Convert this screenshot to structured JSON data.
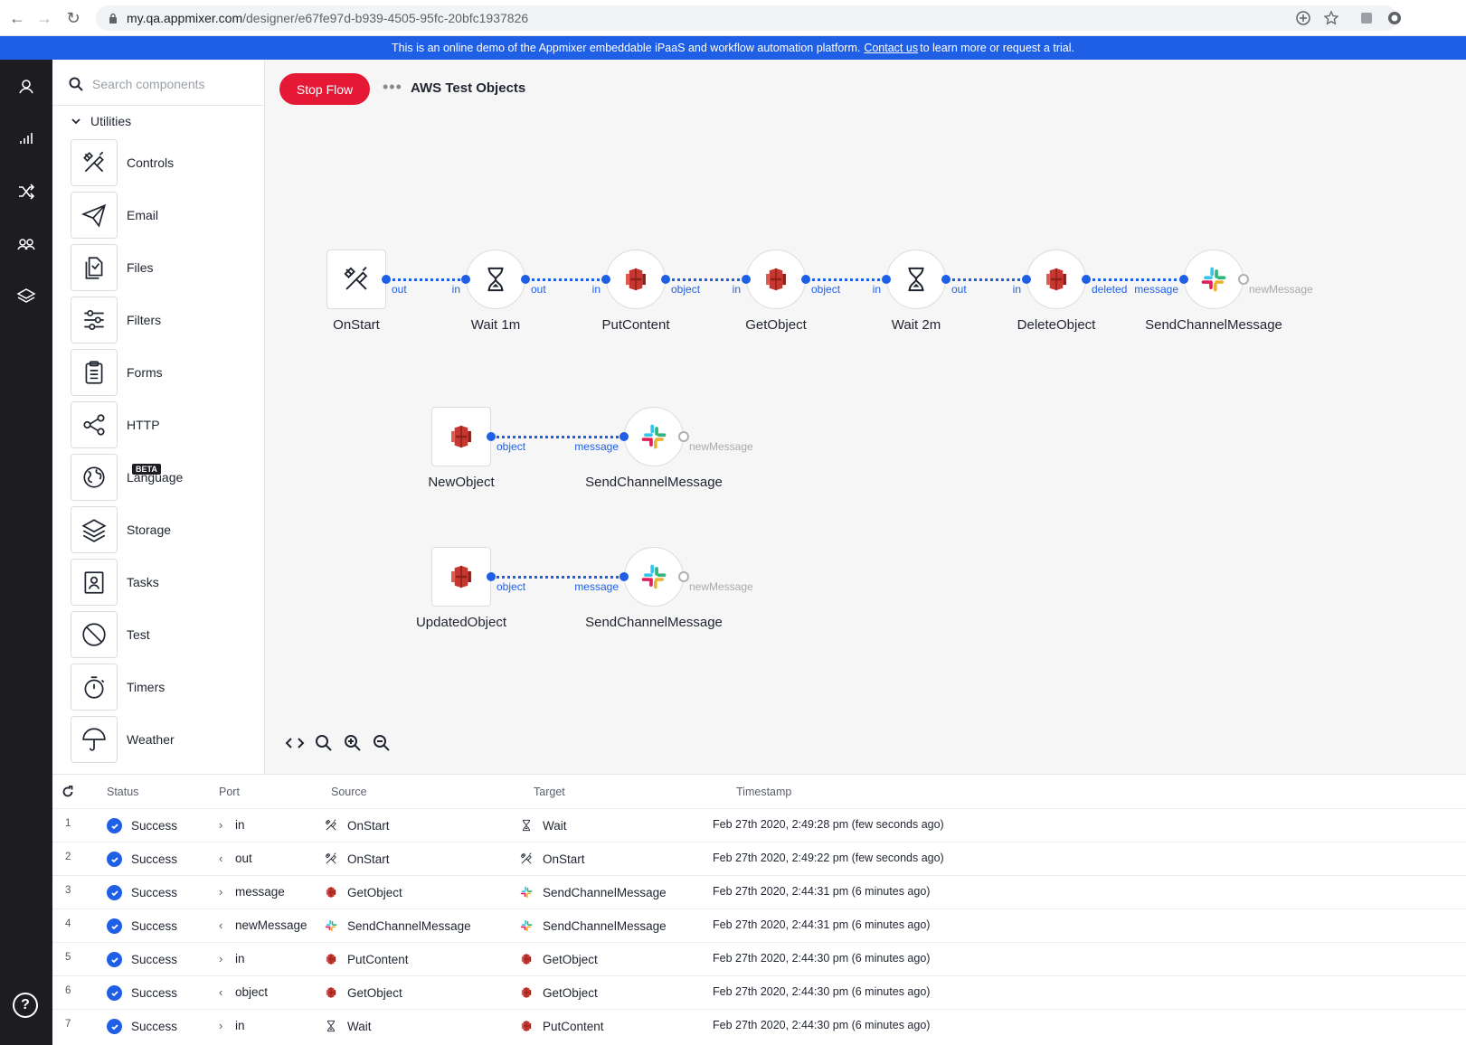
{
  "browser": {
    "url_host": "my.qa.appmixer.com",
    "url_path": "/designer/e67fe97d-b939-4505-95fc-20bfc1937826"
  },
  "banner": {
    "text": "This is an online demo of the Appmixer embeddable iPaaS and workflow automation platform.",
    "link": "Contact us",
    "suffix": "to learn more or request a trial."
  },
  "sidebar": {
    "search_placeholder": "Search components",
    "category": "Utilities",
    "beta_label": "BETA",
    "components": [
      {
        "label": "Controls",
        "icon": "tools-icon"
      },
      {
        "label": "Email",
        "icon": "paper-plane-icon"
      },
      {
        "label": "Files",
        "icon": "files-icon"
      },
      {
        "label": "Filters",
        "icon": "sliders-icon"
      },
      {
        "label": "Forms",
        "icon": "clipboard-icon"
      },
      {
        "label": "HTTP",
        "icon": "share-icon"
      },
      {
        "label": "Language",
        "icon": "globe-icon"
      },
      {
        "label": "Storage",
        "icon": "layers-icon"
      },
      {
        "label": "Tasks",
        "icon": "task-icon"
      },
      {
        "label": "Test",
        "icon": "prohibit-icon"
      },
      {
        "label": "Timers",
        "icon": "stopwatch-icon"
      },
      {
        "label": "Weather",
        "icon": "umbrella-icon"
      }
    ]
  },
  "toolbar": {
    "stop_label": "Stop Flow",
    "more_label": "•••",
    "flow_name": "AWS Test Objects"
  },
  "flow": {
    "row1": [
      {
        "label": "OnStart",
        "icon": "tools-icon"
      },
      {
        "label": "Wait 1m",
        "icon": "hourglass-icon"
      },
      {
        "label": "PutContent",
        "icon": "aws-s3-icon"
      },
      {
        "label": "GetObject",
        "icon": "aws-s3-icon"
      },
      {
        "label": "Wait 2m",
        "icon": "hourglass-icon"
      },
      {
        "label": "DeleteObject",
        "icon": "aws-s3-icon"
      },
      {
        "label": "SendChannelMessage",
        "icon": "slack-icon"
      }
    ],
    "row1_ports": [
      "out",
      "in",
      "out",
      "in",
      "object",
      "in",
      "object",
      "in",
      "out",
      "in",
      "deleted",
      "message",
      "newMessage"
    ],
    "row2": [
      {
        "label": "NewObject",
        "icon": "aws-s3-icon"
      },
      {
        "label": "SendChannelMessage",
        "icon": "slack-icon"
      }
    ],
    "row2_ports": [
      "object",
      "message",
      "newMessage"
    ],
    "row3": [
      {
        "label": "UpdatedObject",
        "icon": "aws-s3-icon"
      },
      {
        "label": "SendChannelMessage",
        "icon": "slack-icon"
      }
    ],
    "row3_ports": [
      "object",
      "message",
      "newMessage"
    ]
  },
  "log": {
    "headers": [
      "Status",
      "Port",
      "Source",
      "Target",
      "Timestamp"
    ],
    "rows": [
      {
        "n": "1",
        "status": "Success",
        "dir": "in",
        "port": "in",
        "source": "OnStart",
        "source_icon": "tools-icon",
        "target": "Wait",
        "target_icon": "hourglass-icon",
        "ts": "Feb 27th 2020, 2:49:28 pm (few seconds ago)"
      },
      {
        "n": "2",
        "status": "Success",
        "dir": "out",
        "port": "out",
        "source": "OnStart",
        "source_icon": "tools-icon",
        "target": "OnStart",
        "target_icon": "tools-icon",
        "ts": "Feb 27th 2020, 2:49:22 pm (few seconds ago)"
      },
      {
        "n": "3",
        "status": "Success",
        "dir": "in",
        "port": "message",
        "source": "GetObject",
        "source_icon": "aws-s3-icon",
        "target": "SendChannelMessage",
        "target_icon": "slack-icon",
        "ts": "Feb 27th 2020, 2:44:31 pm (6 minutes ago)"
      },
      {
        "n": "4",
        "status": "Success",
        "dir": "out",
        "port": "newMessage",
        "source": "SendChannelMessage",
        "source_icon": "slack-icon",
        "target": "SendChannelMessage",
        "target_icon": "slack-icon",
        "ts": "Feb 27th 2020, 2:44:31 pm (6 minutes ago)"
      },
      {
        "n": "5",
        "status": "Success",
        "dir": "in",
        "port": "in",
        "source": "PutContent",
        "source_icon": "aws-s3-icon",
        "target": "GetObject",
        "target_icon": "aws-s3-icon",
        "ts": "Feb 27th 2020, 2:44:30 pm (6 minutes ago)"
      },
      {
        "n": "6",
        "status": "Success",
        "dir": "out",
        "port": "object",
        "source": "GetObject",
        "source_icon": "aws-s3-icon",
        "target": "GetObject",
        "target_icon": "aws-s3-icon",
        "ts": "Feb 27th 2020, 2:44:30 pm (6 minutes ago)"
      },
      {
        "n": "7",
        "status": "Success",
        "dir": "in",
        "port": "in",
        "source": "Wait",
        "source_icon": "hourglass-icon",
        "target": "PutContent",
        "target_icon": "aws-s3-icon",
        "ts": "Feb 27th 2020, 2:44:30 pm (6 minutes ago)"
      }
    ]
  },
  "colors": {
    "accent": "#1f5fe6",
    "stop": "#e51936",
    "rail": "#1c1c21",
    "aws": "#c7372f"
  }
}
